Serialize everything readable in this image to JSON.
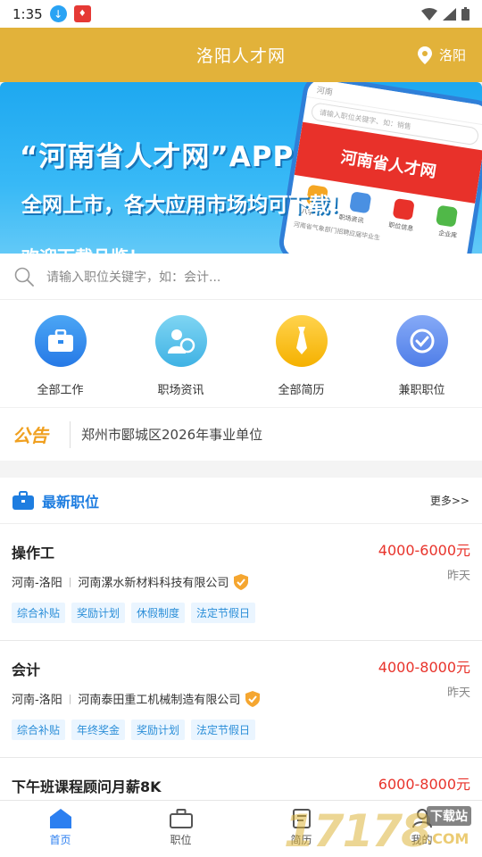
{
  "status": {
    "time": "1:35"
  },
  "header": {
    "title": "洛阳人才网",
    "location": "洛阳"
  },
  "banner": {
    "line1": "“河南省人才网”APP",
    "line2": "全网上市，各大应用市场均可下载！",
    "line3": "欢迎下载品鉴！",
    "phone_brand": "河南省人才网",
    "phone_city": "河南",
    "phone_search": "请输入职位关键字、如：销售",
    "phone_labels": [
      "八字",
      "职场资讯",
      "职位信息",
      "企业库"
    ],
    "phone_footer": "河南省气象部门招聘应届毕业生"
  },
  "search": {
    "placeholder": "请输入职位关键字，如：会计..."
  },
  "menu": [
    {
      "label": "全部工作",
      "icon": "briefcase-icon",
      "color": "#2c89ee"
    },
    {
      "label": "职场资讯",
      "icon": "person-news-icon",
      "color": "#4fc0e8"
    },
    {
      "label": "全部简历",
      "icon": "tie-icon",
      "color": "#f5b800"
    },
    {
      "label": "兼职职位",
      "icon": "clock-check-icon",
      "color": "#5d8ef0"
    }
  ],
  "notice": {
    "tag": "公告",
    "text": "郑州市郾城区2026年事业单位"
  },
  "latest": {
    "title": "最新职位",
    "more": "更多>>"
  },
  "jobs": [
    {
      "name": "操作工",
      "salary": "4000-6000元",
      "when": "昨天",
      "area": "河南-洛阳",
      "company": "河南漯水新材料科技有限公司",
      "tags": [
        "综合补贴",
        "奖励计划",
        "休假制度",
        "法定节假日"
      ]
    },
    {
      "name": "会计",
      "salary": "4000-8000元",
      "when": "昨天",
      "area": "河南-洛阳",
      "company": "河南泰田重工机械制造有限公司",
      "tags": [
        "综合补贴",
        "年终奖金",
        "奖励计划",
        "法定节假日"
      ]
    },
    {
      "name": "下午班课程顾问月薪8K",
      "salary": "6000-8000元",
      "when": "",
      "area": "",
      "company": "",
      "tags": []
    }
  ],
  "nav": [
    {
      "label": "首页",
      "icon": "home-icon",
      "active": true
    },
    {
      "label": "职位",
      "icon": "briefcase-icon",
      "active": false
    },
    {
      "label": "简历",
      "icon": "resume-icon",
      "active": false
    },
    {
      "label": "我的",
      "icon": "user-icon",
      "active": false
    }
  ],
  "watermark": {
    "main": "17178",
    "badge": "下载站",
    "domain": ".COM"
  }
}
